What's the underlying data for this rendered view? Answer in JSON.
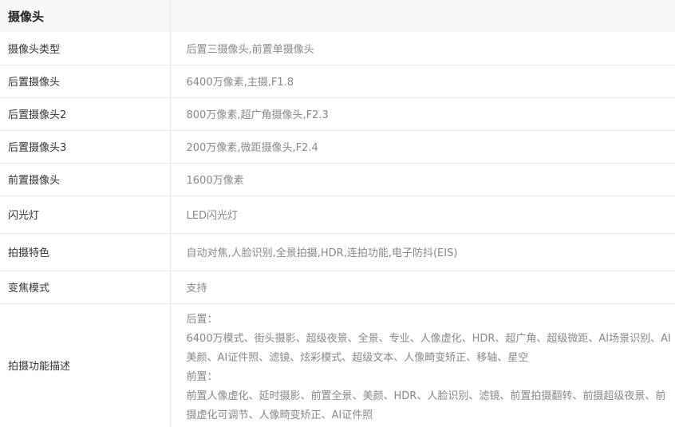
{
  "section": {
    "title": "摄像头"
  },
  "rows": [
    {
      "label": "摄像头类型",
      "value": "后置三摄像头,前置单摄像头"
    },
    {
      "label": "后置摄像头",
      "value": "6400万像素,主摄,F1.8"
    },
    {
      "label": "后置摄像头2",
      "value": "800万像素,超广角摄像头,F2.3"
    },
    {
      "label": "后置摄像头3",
      "value": "200万像素,微距摄像头,F2.4"
    },
    {
      "label": "前置摄像头",
      "value": "1600万像素"
    },
    {
      "label": "闪光灯",
      "value": "LED闪光灯"
    },
    {
      "label": "拍摄特色",
      "value": "自动对焦,人脸识别,全景拍摄,HDR,连拍功能,电子防抖(EIS)"
    },
    {
      "label": "变焦模式",
      "value": "支持"
    }
  ],
  "description": {
    "label": "拍摄功能描述",
    "rear_heading": "后置：",
    "rear_text": "6400万模式、街头摄影、超级夜景、全景、专业、人像虚化、HDR、超广角、超级微距、AI场景识别、AI美颜、AI证件照、滤镜、炫彩模式、超级文本、人像畸变矫正、移轴、星空",
    "front_heading": "前置：",
    "front_text": "前置人像虚化、延时摄影、前置全景、美颜、HDR、人脸识别、滤镜、前置拍摄翻转、前摄超级夜景、前摄虚化可调节、人像畸变矫正、AI证件照"
  }
}
